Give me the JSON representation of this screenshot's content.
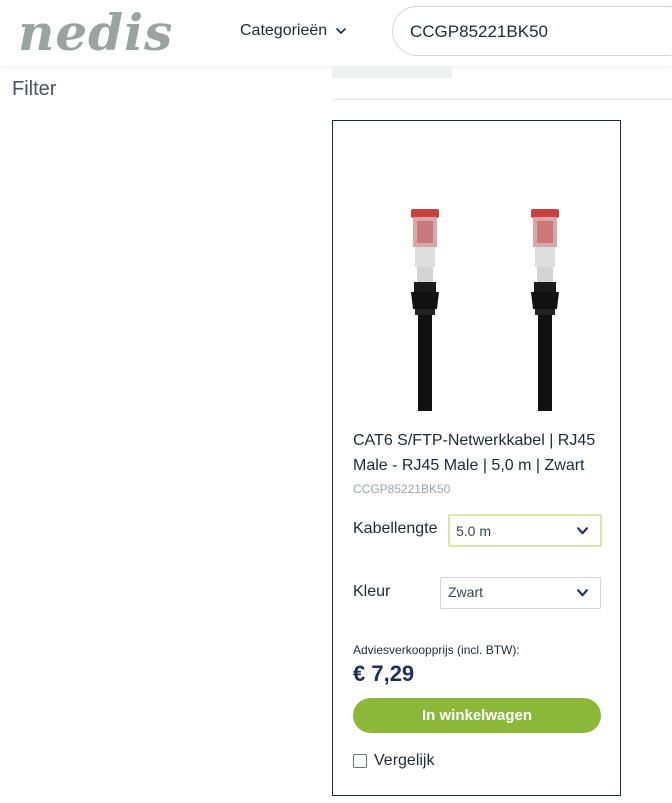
{
  "header": {
    "logo_text": "nedis",
    "nav_categories_label": "Categorieën",
    "search": {
      "value": "CCGP85221BK50"
    }
  },
  "sidebar": {
    "filter_title": "Filter"
  },
  "product": {
    "title": "CAT6 S/FTP-Netwerkkabel | RJ45 Male - RJ45 Male | 5,0 m | Zwart",
    "sku": "CCGP85221BK50",
    "options": {
      "cable_length": {
        "label": "Kabellengte",
        "selected": "5.0 m"
      },
      "color": {
        "label": "Kleur",
        "selected": "Zwart"
      }
    },
    "price_label": "Adviesverkoopprijs (incl. BTW):",
    "price": "€ 7,29",
    "add_to_cart_label": "In winkelwagen",
    "compare_label": "Vergelijk"
  },
  "icons": {
    "categories_chevron": "chevron-down-icon",
    "select_chevron": "chevron-down-icon"
  },
  "colors": {
    "accent_green": "#8cb83a",
    "price_navy": "#1e2f5c",
    "text_dark": "#1e2a36",
    "logo_gray": "#9aa3a0",
    "cable_black": "#111111",
    "connector_red": "#c9403f"
  }
}
